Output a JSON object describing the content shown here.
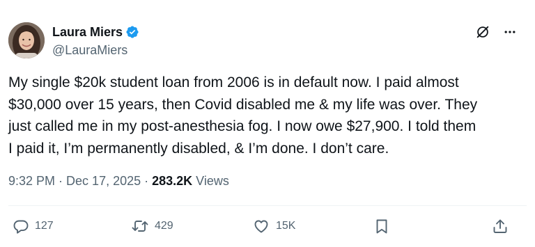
{
  "author": {
    "display_name": "Laura Miers",
    "handle": "@LauraMiers",
    "verified": true,
    "verified_color": "#1d9bf0"
  },
  "tweet": {
    "text": "My single $20k student loan from 2006 is in default now. I paid almost\n$30,000 over 15 years, then Covid disabled me & my life was over. They\njust called me in my post-anesthesia fog. I now owe $27,900. I told them\nI paid it, I’m permanently disabled, & I’m done. I don’t care."
  },
  "meta": {
    "time": "9:32 PM",
    "separator": "·",
    "date": "Dec 17, 2025",
    "separator2": "·",
    "views_count": "283.2K",
    "views_label": "Views"
  },
  "actions": {
    "reply_count": "127",
    "retweet_count": "429",
    "like_count": "15K"
  },
  "icons": {
    "top_right": [
      "grok-icon",
      "more-icon"
    ],
    "action_bar": [
      "reply-icon",
      "retweet-icon",
      "like-icon",
      "bookmark-icon",
      "share-icon"
    ]
  },
  "colors": {
    "text_primary": "#0f1419",
    "text_secondary": "#536471",
    "accent": "#1d9bf0"
  }
}
